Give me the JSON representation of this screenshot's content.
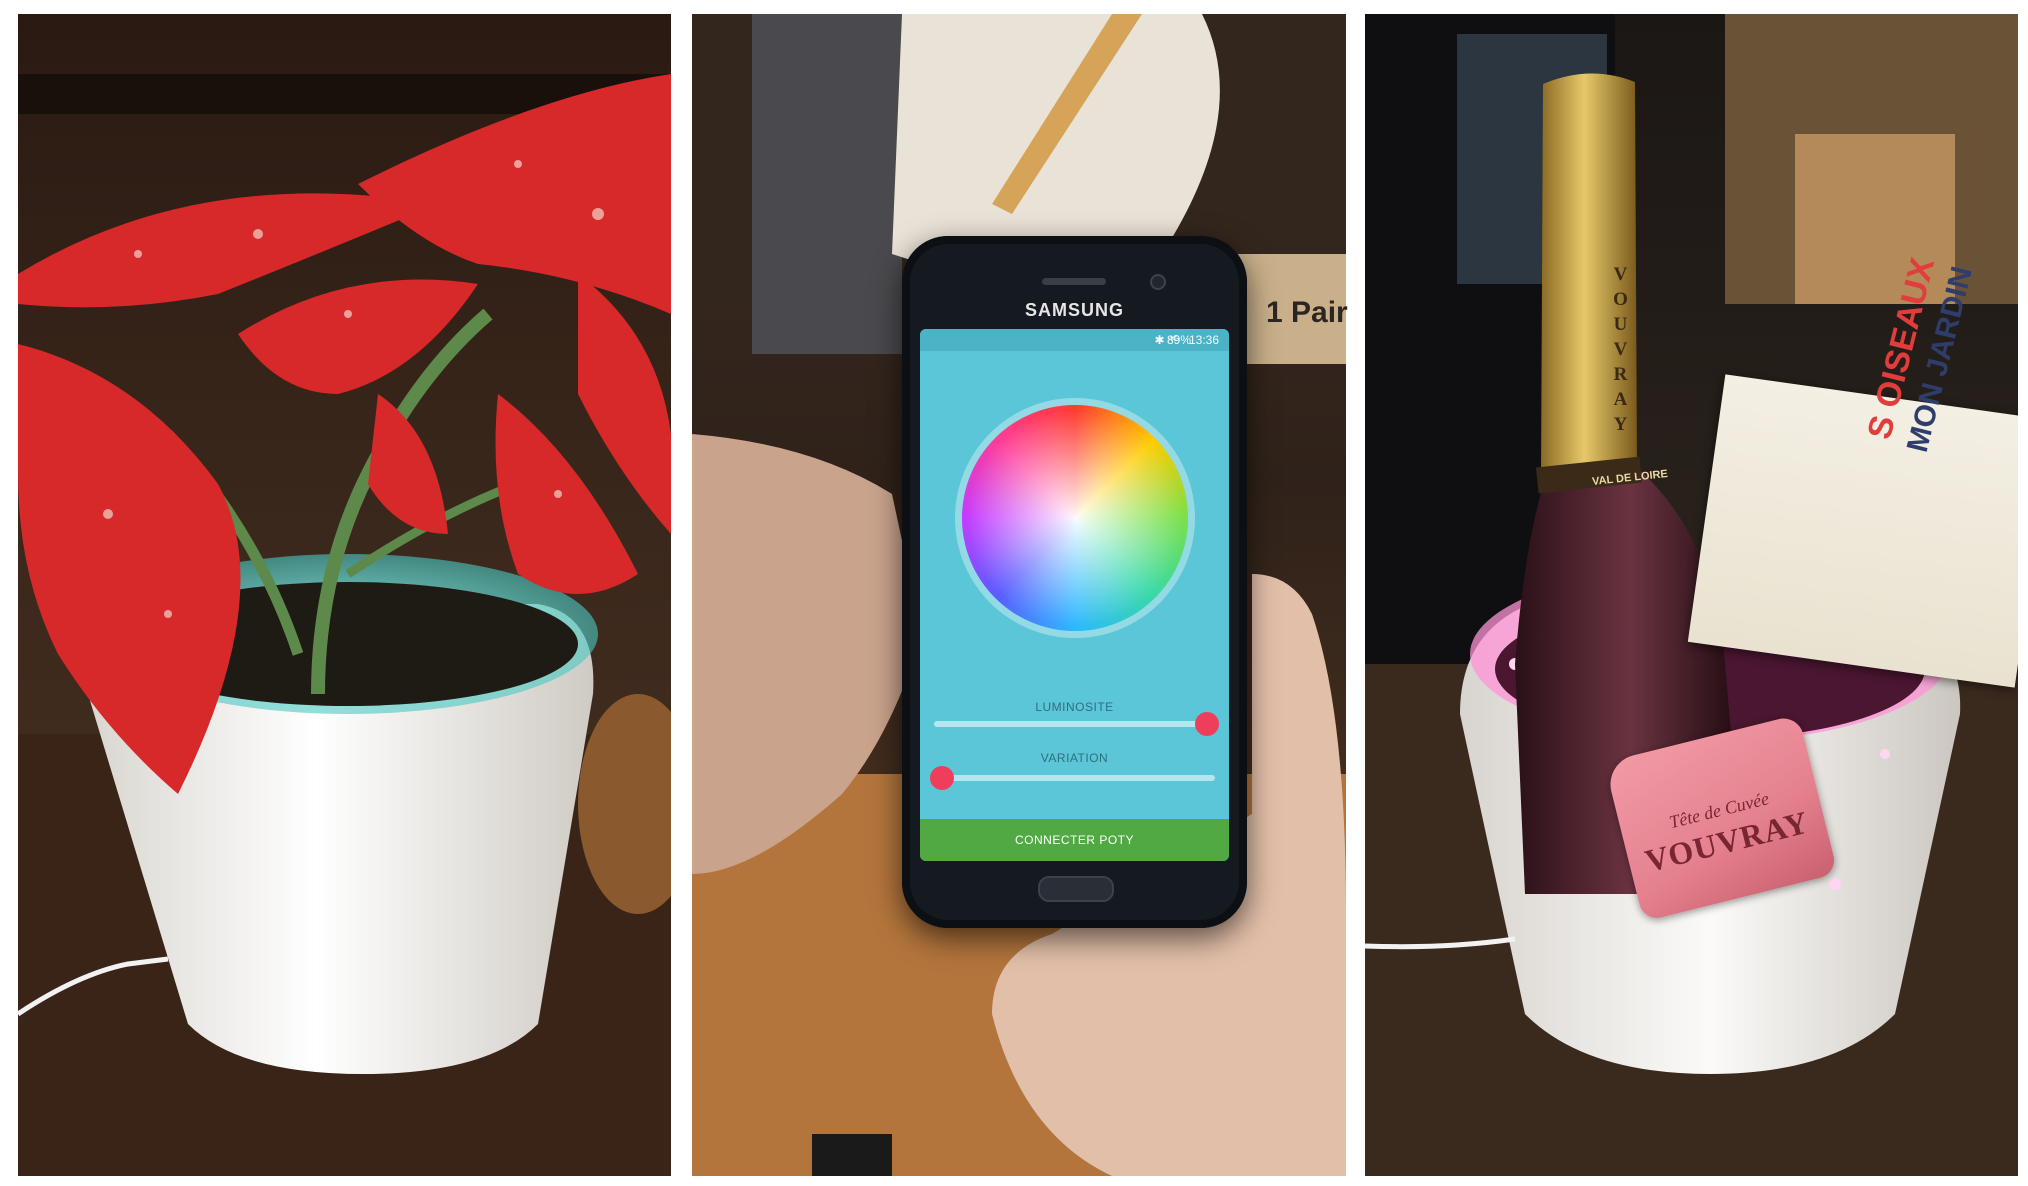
{
  "phone": {
    "brand": "SAMSUNG",
    "status": {
      "icons": "✱ ⁴ᴳ",
      "battery": "89%",
      "time": "13:36"
    },
    "brightness_label": "LUMINOSITE",
    "brightness_value": 0.97,
    "variation_label": "VARIATION",
    "variation_value": 0.03,
    "connect_label": "CONNECTER POTY"
  },
  "bottle": {
    "neck": "VOUVRAY",
    "collar": "VAL DE LOIRE",
    "label_line1": "Tête de Cuvée",
    "label_line2": "VOUVRAY"
  },
  "magazine": {
    "line1": "S OISEAUX",
    "line2": "MON JARDIN"
  },
  "box_text": "1 Pair",
  "colors": {
    "pot_glow_teal": "#7fe6e0",
    "pot_glow_pink": "#ff7fd0",
    "app_bg": "#5bc6d8",
    "button_green": "#51a944"
  }
}
